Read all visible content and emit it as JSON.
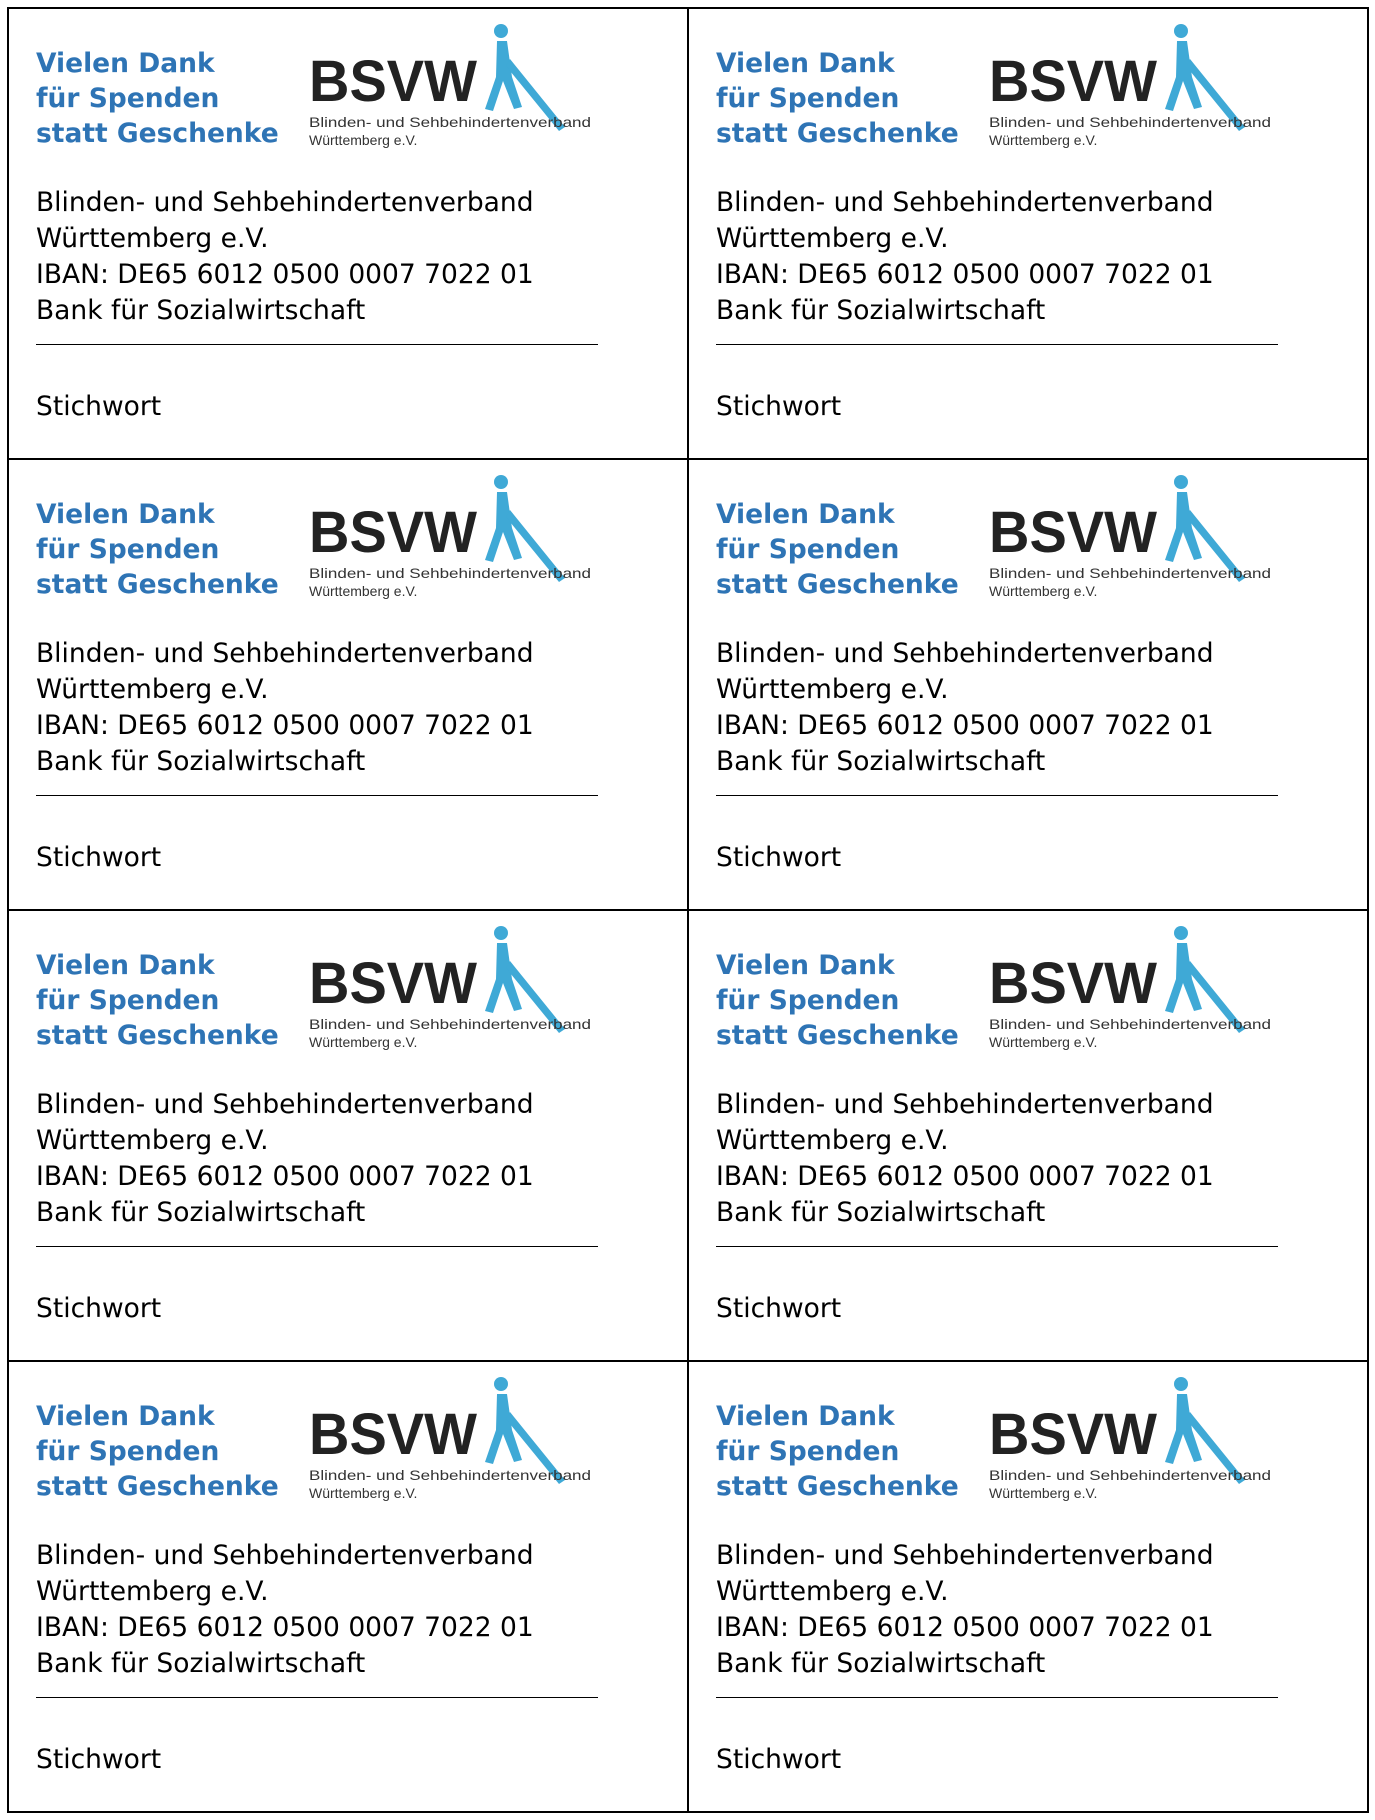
{
  "cards": [
    {
      "thanks": [
        "Vielen Dank",
        "für Spenden",
        "statt Geschenke"
      ],
      "logo": {
        "letters": "BSVW",
        "line1": "Blinden- und Sehbehindertenverband",
        "line2": "Württemberg e.V."
      },
      "address": [
        "Blinden- und Sehbehindertenverband",
        "Württemberg e.V.",
        "IBAN: DE65 6012 0500 0007 7022 01",
        "Bank für Sozialwirtschaft"
      ],
      "keyword_label": "Stichwort"
    },
    {
      "thanks": [
        "Vielen Dank",
        "für Spenden",
        "statt Geschenke"
      ],
      "logo": {
        "letters": "BSVW",
        "line1": "Blinden- und Sehbehindertenverband",
        "line2": "Württemberg e.V."
      },
      "address": [
        "Blinden- und Sehbehindertenverband",
        "Württemberg e.V.",
        "IBAN: DE65 6012 0500 0007 7022 01",
        "Bank für Sozialwirtschaft"
      ],
      "keyword_label": "Stichwort"
    },
    {
      "thanks": [
        "Vielen Dank",
        "für Spenden",
        "statt Geschenke"
      ],
      "logo": {
        "letters": "BSVW",
        "line1": "Blinden- und Sehbehindertenverband",
        "line2": "Württemberg e.V."
      },
      "address": [
        "Blinden- und Sehbehindertenverband",
        "Württemberg e.V.",
        "IBAN: DE65 6012 0500 0007 7022 01",
        "Bank für Sozialwirtschaft"
      ],
      "keyword_label": "Stichwort"
    },
    {
      "thanks": [
        "Vielen Dank",
        "für Spenden",
        "statt Geschenke"
      ],
      "logo": {
        "letters": "BSVW",
        "line1": "Blinden- und Sehbehindertenverband",
        "line2": "Württemberg e.V."
      },
      "address": [
        "Blinden- und Sehbehindertenverband",
        "Württemberg e.V.",
        "IBAN: DE65 6012 0500 0007 7022 01",
        "Bank für Sozialwirtschaft"
      ],
      "keyword_label": "Stichwort"
    },
    {
      "thanks": [
        "Vielen Dank",
        "für Spenden",
        "statt Geschenke"
      ],
      "logo": {
        "letters": "BSVW",
        "line1": "Blinden- und Sehbehindertenverband",
        "line2": "Württemberg e.V."
      },
      "address": [
        "Blinden- und Sehbehindertenverband",
        "Württemberg e.V.",
        "IBAN: DE65 6012 0500 0007 7022 01",
        "Bank für Sozialwirtschaft"
      ],
      "keyword_label": "Stichwort"
    },
    {
      "thanks": [
        "Vielen Dank",
        "für Spenden",
        "statt Geschenke"
      ],
      "logo": {
        "letters": "BSVW",
        "line1": "Blinden- und Sehbehindertenverband",
        "line2": "Württemberg e.V."
      },
      "address": [
        "Blinden- und Sehbehindertenverband",
        "Württemberg e.V.",
        "IBAN: DE65 6012 0500 0007 7022 01",
        "Bank für Sozialwirtschaft"
      ],
      "keyword_label": "Stichwort"
    },
    {
      "thanks": [
        "Vielen Dank",
        "für Spenden",
        "statt Geschenke"
      ],
      "logo": {
        "letters": "BSVW",
        "line1": "Blinden- und Sehbehindertenverband",
        "line2": "Württemberg e.V."
      },
      "address": [
        "Blinden- und Sehbehindertenverband",
        "Württemberg e.V.",
        "IBAN: DE65 6012 0500 0007 7022 01",
        "Bank für Sozialwirtschaft"
      ],
      "keyword_label": "Stichwort"
    },
    {
      "thanks": [
        "Vielen Dank",
        "für Spenden",
        "statt Geschenke"
      ],
      "logo": {
        "letters": "BSVW",
        "line1": "Blinden- und Sehbehindertenverband",
        "line2": "Württemberg e.V."
      },
      "address": [
        "Blinden- und Sehbehindertenverband",
        "Württemberg e.V.",
        "IBAN: DE65 6012 0500 0007 7022 01",
        "Bank für Sozialwirtschaft"
      ],
      "keyword_label": "Stichwort"
    }
  ],
  "colors": {
    "heading": "#2e74b5",
    "logo_text": "#222222",
    "logo_figure": "#3fa9d6",
    "border": "#000000"
  }
}
